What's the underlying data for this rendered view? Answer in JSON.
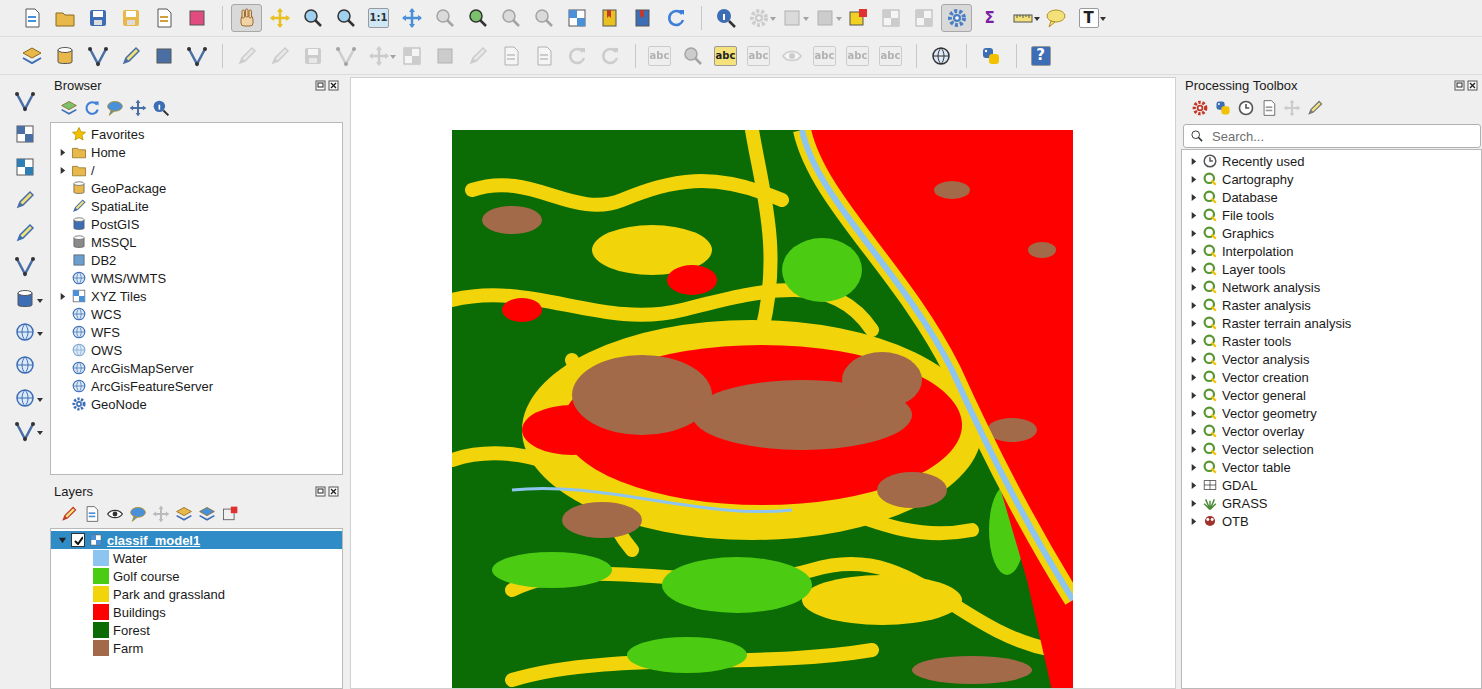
{
  "toolbars": [
    {
      "items": [
        {
          "kind": "icon",
          "selected": false,
          "disabled": false
        },
        {
          "kind": "icon",
          "selected": false,
          "disabled": false
        },
        {
          "kind": "icon",
          "selected": false,
          "disabled": false
        },
        {
          "kind": "icon",
          "selected": false,
          "disabled": false
        },
        {
          "kind": "icon",
          "selected": false,
          "disabled": false
        },
        {
          "kind": "icon",
          "selected": false,
          "disabled": false
        },
        {
          "kind": "separator"
        },
        {
          "kind": "icon",
          "selected": true,
          "disabled": false
        },
        {
          "kind": "icon",
          "selected": false,
          "disabled": false
        },
        {
          "kind": "icon",
          "selected": false,
          "disabled": false
        },
        {
          "kind": "icon",
          "selected": false,
          "disabled": false
        },
        {
          "kind": "glyph",
          "text": "1:1",
          "selected": false,
          "disabled": false
        },
        {
          "kind": "icon",
          "selected": false,
          "disabled": false
        },
        {
          "kind": "icon",
          "selected": false,
          "disabled": true
        },
        {
          "kind": "icon",
          "selected": false,
          "disabled": false
        },
        {
          "kind": "icon",
          "selected": false,
          "disabled": true
        },
        {
          "kind": "icon",
          "selected": false,
          "disabled": true
        },
        {
          "kind": "icon",
          "selected": false,
          "disabled": false
        },
        {
          "kind": "icon",
          "selected": false,
          "disabled": false
        },
        {
          "kind": "icon",
          "selected": false,
          "disabled": false
        },
        {
          "kind": "icon",
          "selected": false,
          "disabled": false
        },
        {
          "kind": "separator"
        },
        {
          "kind": "icon",
          "selected": false,
          "disabled": false
        },
        {
          "kind": "icon",
          "selected": false,
          "disabled": true
        },
        {
          "kind": "icon",
          "selected": false,
          "disabled": true
        },
        {
          "kind": "icon",
          "selected": false,
          "disabled": true
        },
        {
          "kind": "icon",
          "selected": false,
          "disabled": false
        },
        {
          "kind": "icon",
          "selected": false,
          "disabled": true
        },
        {
          "kind": "icon",
          "selected": false,
          "disabled": true
        },
        {
          "kind": "icon",
          "selected": true,
          "disabled": false
        },
        {
          "kind": "glyph",
          "text": "Σ",
          "selected": false,
          "disabled": false
        },
        {
          "kind": "icon",
          "selected": false,
          "disabled": false
        },
        {
          "kind": "icon",
          "selected": false,
          "disabled": false
        },
        {
          "kind": "glyph",
          "text": "T",
          "selected": false,
          "disabled": false
        }
      ]
    },
    {
      "items": [
        {
          "kind": "icon",
          "selected": false,
          "disabled": false
        },
        {
          "kind": "icon",
          "selected": false,
          "disabled": false
        },
        {
          "kind": "icon",
          "selected": false,
          "disabled": false
        },
        {
          "kind": "icon",
          "selected": false,
          "disabled": false
        },
        {
          "kind": "icon",
          "selected": false,
          "disabled": false
        },
        {
          "kind": "icon",
          "selected": false,
          "disabled": false
        },
        {
          "kind": "separator"
        },
        {
          "kind": "icon",
          "selected": false,
          "disabled": true
        },
        {
          "kind": "icon",
          "selected": false,
          "disabled": true
        },
        {
          "kind": "icon",
          "selected": false,
          "disabled": true
        },
        {
          "kind": "icon",
          "selected": false,
          "disabled": true
        },
        {
          "kind": "icon",
          "selected": false,
          "disabled": true
        },
        {
          "kind": "icon",
          "selected": false,
          "disabled": true
        },
        {
          "kind": "icon",
          "selected": false,
          "disabled": true
        },
        {
          "kind": "icon",
          "selected": false,
          "disabled": true
        },
        {
          "kind": "icon",
          "selected": false,
          "disabled": true
        },
        {
          "kind": "icon",
          "selected": false,
          "disabled": true
        },
        {
          "kind": "icon",
          "selected": false,
          "disabled": true
        },
        {
          "kind": "icon",
          "selected": false,
          "disabled": true
        },
        {
          "kind": "separator"
        },
        {
          "kind": "glyph",
          "text": "abc",
          "selected": false,
          "disabled": true
        },
        {
          "kind": "icon",
          "selected": false,
          "disabled": true
        },
        {
          "kind": "glyph",
          "text": "abc",
          "selected": false,
          "disabled": false
        },
        {
          "kind": "glyph",
          "text": "abc",
          "selected": false,
          "disabled": true
        },
        {
          "kind": "icon",
          "selected": false,
          "disabled": true
        },
        {
          "kind": "glyph",
          "text": "abc",
          "selected": false,
          "disabled": true
        },
        {
          "kind": "glyph",
          "text": "abc",
          "selected": false,
          "disabled": true
        },
        {
          "kind": "glyph",
          "text": "abc",
          "selected": false,
          "disabled": true
        },
        {
          "kind": "separator"
        },
        {
          "kind": "icon",
          "selected": false,
          "disabled": false
        },
        {
          "kind": "separator"
        },
        {
          "kind": "icon",
          "selected": false,
          "disabled": false
        },
        {
          "kind": "separator"
        },
        {
          "kind": "glyph",
          "text": "?",
          "selected": false,
          "disabled": false
        }
      ]
    }
  ],
  "browser": {
    "title": "Browser",
    "items": [
      {
        "label": "Favorites",
        "expandable": false,
        "expanded": false
      },
      {
        "label": "Home",
        "expandable": true,
        "expanded": false
      },
      {
        "label": "/",
        "expandable": true,
        "expanded": false
      },
      {
        "label": "GeoPackage",
        "expandable": false,
        "expanded": false
      },
      {
        "label": "SpatiaLite",
        "expandable": false,
        "expanded": false
      },
      {
        "label": "PostGIS",
        "expandable": false,
        "expanded": false
      },
      {
        "label": "MSSQL",
        "expandable": false,
        "expanded": false
      },
      {
        "label": "DB2",
        "expandable": false,
        "expanded": false
      },
      {
        "label": "WMS/WMTS",
        "expandable": false,
        "expanded": false
      },
      {
        "label": "XYZ Tiles",
        "expandable": true,
        "expanded": false
      },
      {
        "label": "WCS",
        "expandable": false,
        "expanded": false
      },
      {
        "label": "WFS",
        "expandable": false,
        "expanded": false
      },
      {
        "label": "OWS",
        "expandable": false,
        "expanded": false
      },
      {
        "label": "ArcGisMapServer",
        "expandable": false,
        "expanded": false
      },
      {
        "label": "ArcGisFeatureServer",
        "expandable": false,
        "expanded": false
      },
      {
        "label": "GeoNode",
        "expandable": false,
        "expanded": false
      }
    ]
  },
  "layers": {
    "title": "Layers",
    "layer": {
      "name": "classif_model1",
      "checked": true,
      "expanded": true,
      "selected": true
    },
    "legend": [
      {
        "label": "Water",
        "color": "#8ec5f0"
      },
      {
        "label": "Golf course",
        "color": "#4bcc12"
      },
      {
        "label": "Park and grassland",
        "color": "#f2d40a"
      },
      {
        "label": "Buildings",
        "color": "#ff0000"
      },
      {
        "label": "Forest",
        "color": "#0b6b04"
      },
      {
        "label": "Farm",
        "color": "#a36a4a"
      }
    ]
  },
  "toolbox": {
    "title": "Processing Toolbox",
    "search": {
      "placeholder": "Search..."
    },
    "items": [
      {
        "label": "Recently used",
        "kind": "history",
        "expanded": false
      },
      {
        "label": "Cartography",
        "kind": "qgis",
        "expanded": false
      },
      {
        "label": "Database",
        "kind": "qgis",
        "expanded": false
      },
      {
        "label": "File tools",
        "kind": "qgis",
        "expanded": false
      },
      {
        "label": "Graphics",
        "kind": "qgis",
        "expanded": false
      },
      {
        "label": "Interpolation",
        "kind": "qgis",
        "expanded": false
      },
      {
        "label": "Layer tools",
        "kind": "qgis",
        "expanded": false
      },
      {
        "label": "Network analysis",
        "kind": "qgis",
        "expanded": false
      },
      {
        "label": "Raster analysis",
        "kind": "qgis",
        "expanded": false
      },
      {
        "label": "Raster terrain analysis",
        "kind": "qgis",
        "expanded": false
      },
      {
        "label": "Raster tools",
        "kind": "qgis",
        "expanded": false
      },
      {
        "label": "Vector analysis",
        "kind": "qgis",
        "expanded": false
      },
      {
        "label": "Vector creation",
        "kind": "qgis",
        "expanded": false
      },
      {
        "label": "Vector general",
        "kind": "qgis",
        "expanded": false
      },
      {
        "label": "Vector geometry",
        "kind": "qgis",
        "expanded": false
      },
      {
        "label": "Vector overlay",
        "kind": "qgis",
        "expanded": false
      },
      {
        "label": "Vector selection",
        "kind": "qgis",
        "expanded": false
      },
      {
        "label": "Vector table",
        "kind": "qgis",
        "expanded": false
      },
      {
        "label": "GDAL",
        "kind": "gdal",
        "expanded": false
      },
      {
        "label": "GRASS",
        "kind": "grass",
        "expanded": false
      },
      {
        "label": "OTB",
        "kind": "otb",
        "expanded": false
      }
    ]
  }
}
